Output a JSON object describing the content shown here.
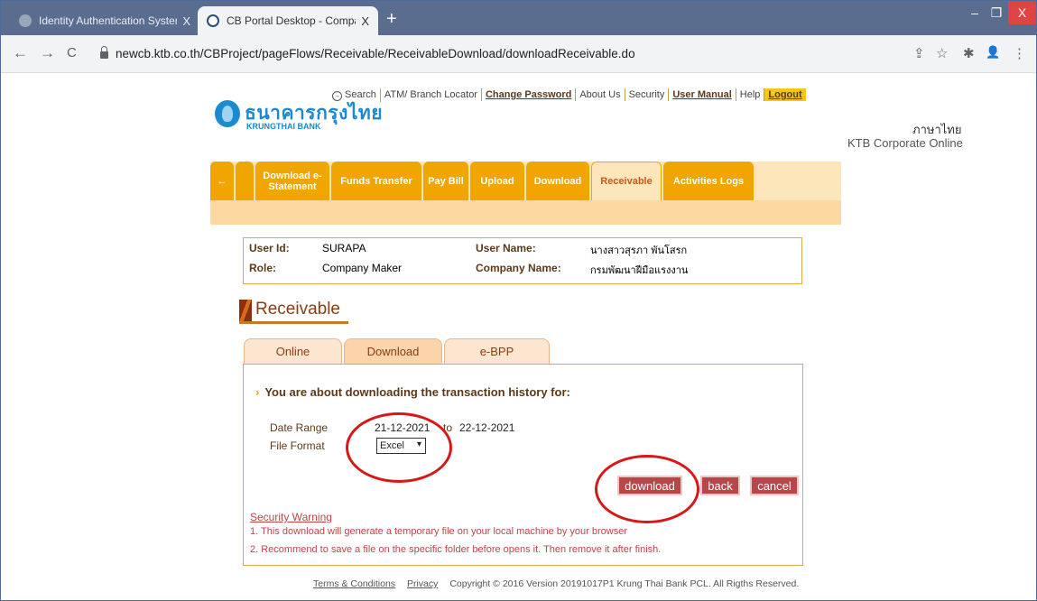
{
  "browser": {
    "tabs": [
      {
        "title": "Identity Authentication System",
        "close": "X"
      },
      {
        "title": "CB Portal Desktop - Company U",
        "close": "X"
      }
    ],
    "new_tab": "+",
    "window": {
      "minimize": "–",
      "maximize": "❐",
      "close": "X"
    },
    "nav": {
      "back": "←",
      "forward": "→",
      "reload": "C"
    },
    "url": "newcb.ktb.co.th/CBProject/pageFlows/Receivable/ReceivableDownload/downloadReceivable.do",
    "tools": [
      "⇪",
      "☆",
      "✱",
      "👤",
      "⋮"
    ]
  },
  "header": {
    "bank_name_thai": "ธนาคารกรุงไทย",
    "bank_name_en": "KRUNGTHAI BANK",
    "topnav": [
      "Search",
      "ATM/ Branch Locator",
      "Change Password",
      "About Us",
      "Security",
      "User Manual",
      "Help",
      "Logout"
    ],
    "language": "ภาษาไทย",
    "product": "KTB Corporate Online"
  },
  "menu": {
    "back": "←",
    "items": [
      "Download e-Statement",
      "Funds Transfer",
      "Pay Bill",
      "Upload",
      "Download",
      "Receivable",
      "Activities Logs"
    ],
    "active": "Receivable",
    "more": "→"
  },
  "user": {
    "user_id_label": "User Id:",
    "user_id": "SURAPA",
    "user_name_label": "User Name:",
    "user_name": "นางสาวสุรภา พันโสรก",
    "role_label": "Role:",
    "role": "Company Maker",
    "company_label": "Company Name:",
    "company": "กรมพัฒนาฝีมือแรงงาน"
  },
  "section": {
    "title": "Receivable"
  },
  "subtabs": [
    "Online",
    "Download",
    "e-BPP"
  ],
  "form": {
    "heading": "You are about downloading the transaction history for:",
    "date_range_label": "Date Range",
    "date_from": "21-12-2021",
    "date_to_sep": "to",
    "date_to": "22-12-2021",
    "file_format_label": "File Format",
    "file_format_value": "Excel"
  },
  "buttons": {
    "download": "download",
    "back": "back",
    "cancel": "cancel"
  },
  "security": {
    "title": "Security Warning",
    "line1": "1. This download will generate a temporary file on your local machine by  your browser",
    "line2": "2. Recommend to save a file on the specific folder before opens it. Then remove it after finish."
  },
  "footer": {
    "terms": "Terms & Conditions",
    "privacy": "Privacy",
    "copyright": "Copyright © 2016 Version 20191017P1 Krung Thai Bank PCL. All Rigths Reserved."
  },
  "colors": {
    "accent": "#f0a500",
    "button": "#b8474a",
    "annotation": "#d81818"
  }
}
